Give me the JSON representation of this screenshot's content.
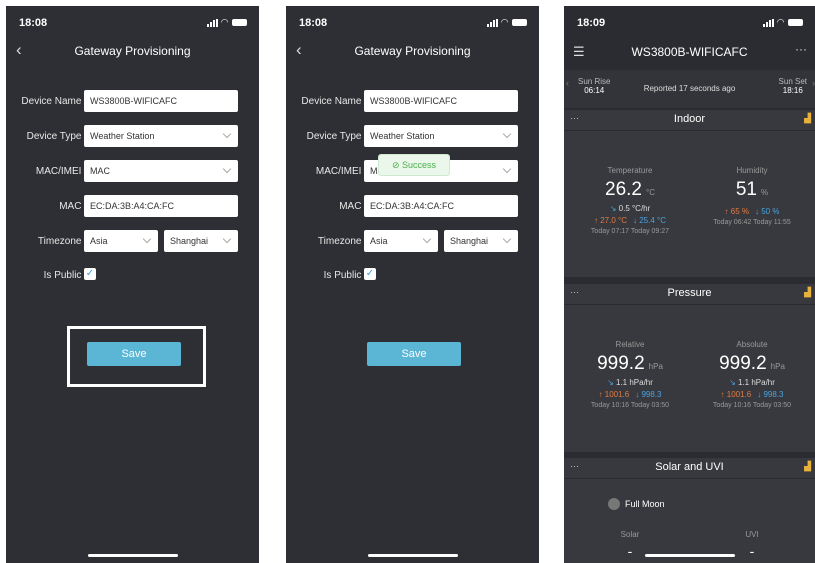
{
  "phone1": {
    "time": "18:08",
    "title": "Gateway Provisioning",
    "back": "‹",
    "fields": {
      "device_name_label": "Device Name :",
      "device_name_value": "WS3800B-WIFICAFC",
      "device_type_label": "Device Type :",
      "device_type_value": "Weather Station",
      "mac_imei_label": "MAC/IMEI :",
      "mac_imei_value": "MAC",
      "mac_label": "MAC :",
      "mac_value": "EC:DA:3B:A4:CA:FC",
      "timezone_label": "Timezone :",
      "timezone_region": "Asia",
      "timezone_city": "Shanghai",
      "is_public_label": "Is Public :"
    },
    "save_label": "Save"
  },
  "phone2": {
    "time": "18:08",
    "title": "Gateway Provisioning",
    "back": "‹",
    "fields": {
      "device_name_label": "Device Name :",
      "device_name_value": "WS3800B-WIFICAFC",
      "device_type_label": "Device Type :",
      "device_type_value": "Weather Station",
      "mac_imei_label": "MAC/IMEI :",
      "mac_imei_value": "M",
      "mac_label": "MAC :",
      "mac_value": "EC:DA:3B:A4:CA:FC",
      "timezone_label": "Timezone :",
      "timezone_region": "Asia",
      "timezone_city": "Shanghai",
      "is_public_label": "Is Public :"
    },
    "toast": "Success",
    "save_label": "Save"
  },
  "phone3": {
    "time": "18:09",
    "title": "WS3800B-WIFICAFC",
    "sun": {
      "rise_label": "Sun Rise",
      "rise_time": "06:14",
      "reported": "Reported 17 seconds ago",
      "set_label": "Sun Set",
      "set_time": "18:16"
    },
    "indoor": {
      "title": "Indoor",
      "temp_label": "Temperature",
      "temp_value": "26.2",
      "temp_unit": "°C",
      "temp_trend": "0.5 °C/hr",
      "temp_hi": "↑ 27.0 °C",
      "temp_lo": "↓ 25.4 °C",
      "temp_hi_time": "Today 07:17",
      "temp_lo_time": "Today 09:27",
      "hum_label": "Humidity",
      "hum_value": "51",
      "hum_unit": "%",
      "hum_hi": "↑ 65 %",
      "hum_lo": "↓ 50 %",
      "hum_hi_time": "Today 06:42",
      "hum_lo_time": "Today 11:55"
    },
    "pressure": {
      "title": "Pressure",
      "rel_label": "Relative",
      "rel_value": "999.2",
      "rel_unit": "hPa",
      "rel_trend": "1.1 hPa/hr",
      "rel_hi": "↑ 1001.6",
      "rel_lo": "↓ 998.3",
      "rel_hi_time": "Today 10:16",
      "rel_lo_time": "Today 03:50",
      "abs_label": "Absolute",
      "abs_value": "999.2",
      "abs_unit": "hPa",
      "abs_trend": "1.1 hPa/hr",
      "abs_hi": "↑ 1001.6",
      "abs_lo": "↓ 998.3",
      "abs_hi_time": "Today 10:16",
      "abs_lo_time": "Today 03:50"
    },
    "solar": {
      "title": "Solar and UVI",
      "moon": "Full Moon",
      "solar_label": "Solar",
      "uvi_label": "UVI",
      "solar_value": "-",
      "uvi_value": "-"
    }
  },
  "colors": {
    "background": "#2e2f34",
    "accent": "#5bb6d6",
    "success": "#4caf50",
    "high": "#e07b42",
    "low": "#4aa3df",
    "chart_icon": "#e8b23a"
  }
}
